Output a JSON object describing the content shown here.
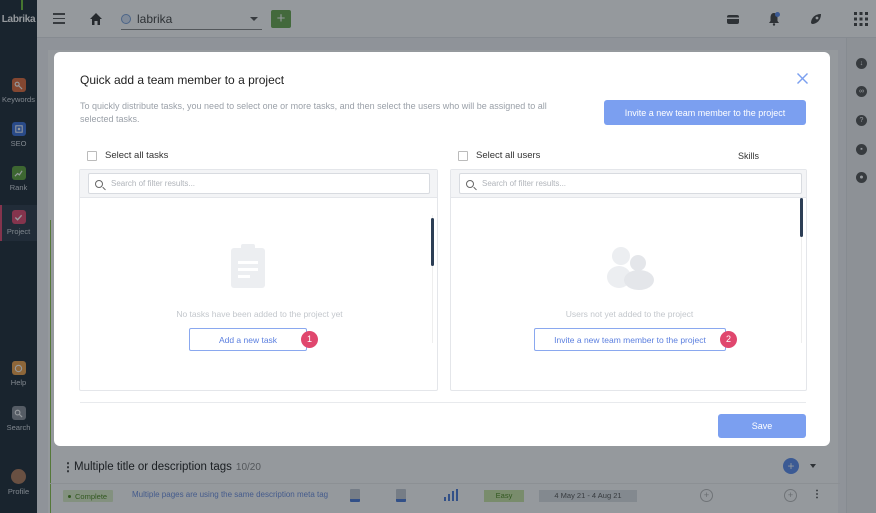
{
  "app": {
    "logo_text": "Labrika",
    "project_name": "labrika"
  },
  "sidebar": {
    "items": [
      {
        "label": "Keywords",
        "color": "#e06a3b"
      },
      {
        "label": "SEO",
        "color": "#3b6fd9"
      },
      {
        "label": "Rank",
        "color": "#5fa33b"
      },
      {
        "label": "Project",
        "color": "#e0476e"
      },
      {
        "label": "Help",
        "color": "#f0a24a"
      },
      {
        "label": "Search",
        "color": "#8a9099"
      },
      {
        "label": "Profile",
        "color": "#b07a5a"
      }
    ]
  },
  "background": {
    "group_title": "Multiple title or description tags",
    "group_count": "10/20",
    "row": {
      "status": "Complete",
      "description": "Multiple pages are using the same description meta tag",
      "difficulty": "Easy",
      "dates": "4 May 21 - 4 Aug 21"
    }
  },
  "modal": {
    "title": "Quick add a team member to a project",
    "description": "To quickly distribute tasks, you need to select one or more tasks, and then select the users who will be assigned to all selected tasks.",
    "invite_top_label": "Invite a new team member to the project",
    "tasks": {
      "select_all_label": "Select all tasks",
      "search_placeholder": "Search of filter results...",
      "empty_message": "No tasks have been added to the project yet",
      "add_button_label": "Add a new task",
      "badge": "1"
    },
    "users": {
      "select_all_label": "Select all users",
      "skills_label": "Skills",
      "search_placeholder": "Search of filter results...",
      "empty_message": "Users not yet added to the project",
      "invite_button_label": "Invite a new team member to the project",
      "badge": "2"
    },
    "save_label": "Save"
  },
  "colors": {
    "accent": "#7b9ff0",
    "badge": "#e0476e",
    "sidebar_bg": "#1e2a36"
  }
}
